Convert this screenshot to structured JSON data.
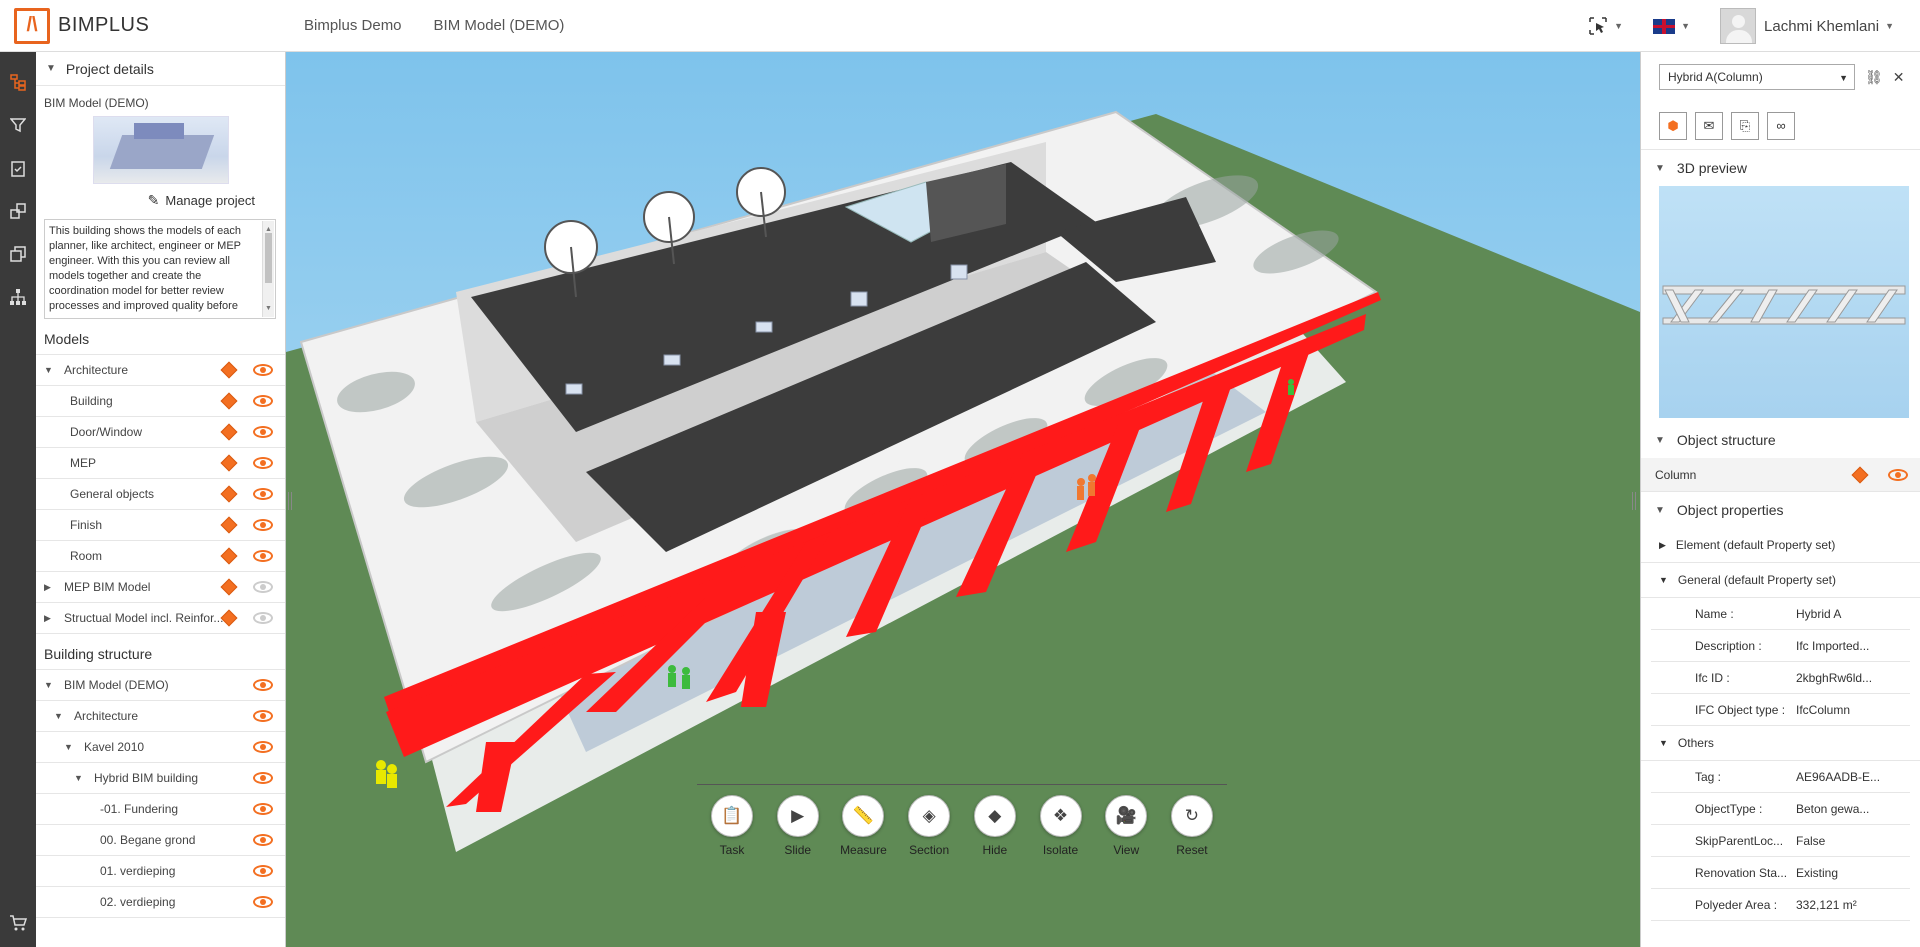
{
  "app": {
    "logo_text": "BIMPLUS"
  },
  "header": {
    "breadcrumbs": [
      "Bimplus Demo",
      "BIM Model (DEMO)"
    ],
    "user_name": "Lachmi Khemlani"
  },
  "left_panel": {
    "project_details_title": "Project details",
    "project_name": "BIM Model (DEMO)",
    "manage_label": "Manage project",
    "description": "This building shows the models of each planner, like architect, engineer or MEP engineer. With this you can review all models together and create the coordination model for better review processes and improved quality before",
    "models_title": "Models",
    "models": [
      {
        "label": "Architecture",
        "expanded": true,
        "indent": 0,
        "visible": true
      },
      {
        "label": "Building",
        "indent": 1,
        "visible": true
      },
      {
        "label": "Door/Window",
        "indent": 1,
        "visible": true
      },
      {
        "label": "MEP",
        "indent": 1,
        "visible": true
      },
      {
        "label": "General objects",
        "indent": 1,
        "visible": true
      },
      {
        "label": "Finish",
        "indent": 1,
        "visible": true
      },
      {
        "label": "Room",
        "indent": 1,
        "visible": true
      },
      {
        "label": "MEP BIM Model",
        "expanded": false,
        "indent": 0,
        "visible": false
      },
      {
        "label": "Structual Model incl. Reinfor...",
        "expanded": false,
        "indent": 0,
        "visible": false
      }
    ],
    "building_structure_title": "Building structure",
    "building_structure": [
      {
        "label": "BIM Model (DEMO)",
        "expanded": true
      },
      {
        "label": "Architecture",
        "expanded": true
      },
      {
        "label": "Kavel 2010",
        "expanded": true
      },
      {
        "label": "Hybrid BIM building",
        "expanded": true
      },
      {
        "label": "-01. Fundering"
      },
      {
        "label": "00. Begane grond"
      },
      {
        "label": "01. verdieping"
      },
      {
        "label": "02. verdieping"
      }
    ]
  },
  "toolbar": [
    {
      "label": "Task",
      "icon": "task-icon"
    },
    {
      "label": "Slide",
      "icon": "slide-icon"
    },
    {
      "label": "Measure",
      "icon": "ruler-icon"
    },
    {
      "label": "Section",
      "icon": "section-cube-icon"
    },
    {
      "label": "Hide",
      "icon": "hide-icon"
    },
    {
      "label": "Isolate",
      "icon": "isolate-icon"
    },
    {
      "label": "View",
      "icon": "camera-icon"
    },
    {
      "label": "Reset",
      "icon": "reset-icon"
    }
  ],
  "right_panel": {
    "selected_object": "Hybrid A(Column)",
    "preview_title": "3D preview",
    "object_structure_title": "Object structure",
    "object_structure_item": "Column",
    "object_properties_title": "Object properties",
    "element_set": "Element (default Property set)",
    "general_set": "General (default Property set)",
    "general_props": [
      {
        "key": "Name :",
        "value": "Hybrid A"
      },
      {
        "key": "Description :",
        "value": "Ifc Imported..."
      },
      {
        "key": "Ifc ID :",
        "value": "2kbghRw6ld..."
      },
      {
        "key": "IFC Object type :",
        "value": "IfcColumn"
      }
    ],
    "others_set": "Others",
    "other_props": [
      {
        "key": "Tag :",
        "value": "AE96AADB-E..."
      },
      {
        "key": "ObjectType :",
        "value": "Beton gewa..."
      },
      {
        "key": "SkipParentLoc...",
        "value": "False"
      },
      {
        "key": "Renovation Sta...",
        "value": "Existing"
      },
      {
        "key": "Polyeder Area :",
        "value": "332,121 m²"
      }
    ]
  },
  "colors": {
    "accent": "#f36f21",
    "selection_red": "#ff1a1a",
    "ground": "#5f8a55",
    "sky": "#8ccbf0"
  }
}
